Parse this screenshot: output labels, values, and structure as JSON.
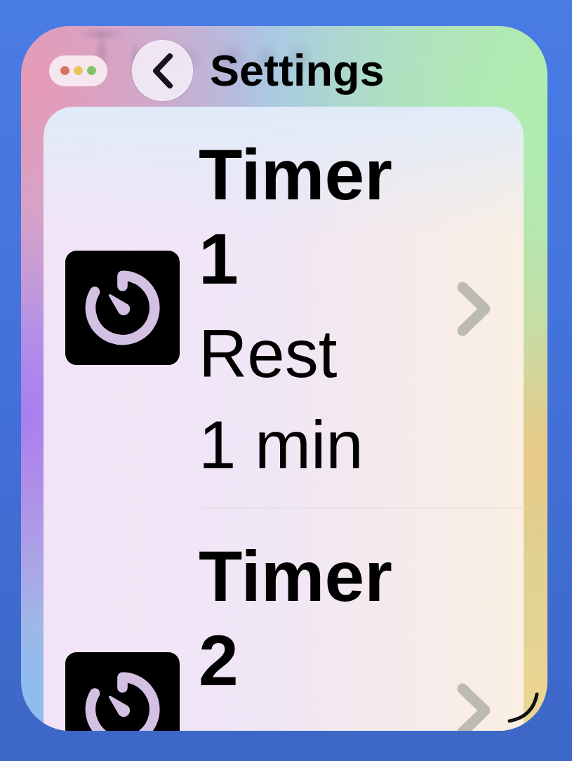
{
  "window": {
    "controls": [
      {
        "color": "#d8735f"
      },
      {
        "color": "#e6c45c"
      },
      {
        "color": "#84c16a"
      }
    ]
  },
  "navigation": {
    "title": "Settings"
  },
  "timers": [
    {
      "title": "Timer 1",
      "lines": [
        "Rest",
        "1 min"
      ]
    },
    {
      "title": "Timer 2"
    }
  ]
}
